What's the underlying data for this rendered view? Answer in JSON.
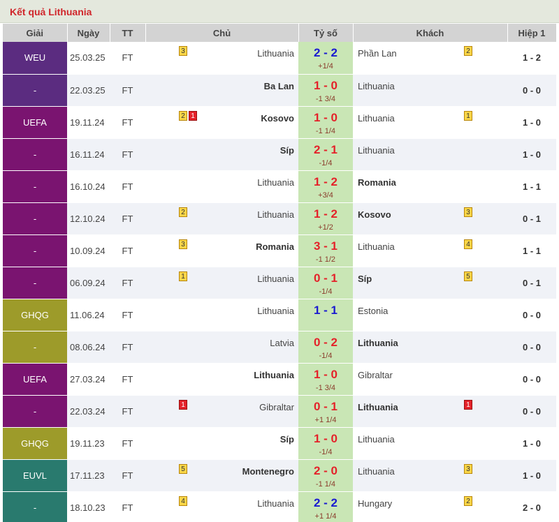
{
  "title": "Kết quả Lithuania",
  "headers": {
    "league": "Giải",
    "date": "Ngày",
    "status": "TT",
    "home": "Chủ",
    "score": "Tỷ số",
    "away": "Khách",
    "half": "Hiệp 1"
  },
  "colors": {
    "purple": "#5b2c80",
    "magenta": "#7a1470",
    "olive": "#9d9b2a",
    "teal": "#297a6e",
    "score_bg": "#c9e6b5",
    "title_red": "#d0262b"
  },
  "matches": [
    {
      "league": "WEU",
      "league_color": "#5b2c80",
      "date": "25.03.25",
      "status": "FT",
      "home": "Lithuania",
      "home_bold": false,
      "home_badges": [
        {
          "n": "3",
          "c": "yellow"
        }
      ],
      "score": "2 - 2",
      "score_color": "blue",
      "handicap": "+1/4",
      "away": "Phần Lan",
      "away_bold": false,
      "away_badges": [
        {
          "n": "2",
          "c": "yellow"
        }
      ],
      "half": "1 - 2"
    },
    {
      "league": "-",
      "league_color": "#5b2c80",
      "date": "22.03.25",
      "status": "FT",
      "home": "Ba Lan",
      "home_bold": true,
      "home_badges": [],
      "score": "1 - 0",
      "score_color": "red",
      "handicap": "-1 3/4",
      "away": "Lithuania",
      "away_bold": false,
      "away_badges": [],
      "half": "0 - 0"
    },
    {
      "league": "UEFA",
      "league_color": "#7a1470",
      "date": "19.11.24",
      "status": "FT",
      "home": "Kosovo",
      "home_bold": true,
      "home_badges": [
        {
          "n": "2",
          "c": "yellow"
        },
        {
          "n": "1",
          "c": "red"
        }
      ],
      "score": "1 - 0",
      "score_color": "red",
      "handicap": "-1 1/4",
      "away": "Lithuania",
      "away_bold": false,
      "away_badges": [
        {
          "n": "1",
          "c": "yellow"
        }
      ],
      "half": "1 - 0"
    },
    {
      "league": "-",
      "league_color": "#7a1470",
      "date": "16.11.24",
      "status": "FT",
      "home": "Síp",
      "home_bold": true,
      "home_badges": [],
      "score": "2 - 1",
      "score_color": "red",
      "handicap": "-1/4",
      "away": "Lithuania",
      "away_bold": false,
      "away_badges": [],
      "half": "1 - 0"
    },
    {
      "league": "-",
      "league_color": "#7a1470",
      "date": "16.10.24",
      "status": "FT",
      "home": "Lithuania",
      "home_bold": false,
      "home_badges": [],
      "score": "1 - 2",
      "score_color": "red",
      "handicap": "+3/4",
      "away": "Romania",
      "away_bold": true,
      "away_badges": [],
      "half": "1 - 1"
    },
    {
      "league": "-",
      "league_color": "#7a1470",
      "date": "12.10.24",
      "status": "FT",
      "home": "Lithuania",
      "home_bold": false,
      "home_badges": [
        {
          "n": "2",
          "c": "yellow"
        }
      ],
      "score": "1 - 2",
      "score_color": "red",
      "handicap": "+1/2",
      "away": "Kosovo",
      "away_bold": true,
      "away_badges": [
        {
          "n": "3",
          "c": "yellow"
        }
      ],
      "half": "0 - 1"
    },
    {
      "league": "-",
      "league_color": "#7a1470",
      "date": "10.09.24",
      "status": "FT",
      "home": "Romania",
      "home_bold": true,
      "home_badges": [
        {
          "n": "3",
          "c": "yellow"
        }
      ],
      "score": "3 - 1",
      "score_color": "red",
      "handicap": "-1 1/2",
      "away": "Lithuania",
      "away_bold": false,
      "away_badges": [
        {
          "n": "4",
          "c": "yellow"
        }
      ],
      "half": "1 - 1"
    },
    {
      "league": "-",
      "league_color": "#7a1470",
      "date": "06.09.24",
      "status": "FT",
      "home": "Lithuania",
      "home_bold": false,
      "home_badges": [
        {
          "n": "1",
          "c": "yellow"
        }
      ],
      "score": "0 - 1",
      "score_color": "red",
      "handicap": "-1/4",
      "away": "Síp",
      "away_bold": true,
      "away_badges": [
        {
          "n": "5",
          "c": "yellow"
        }
      ],
      "half": "0 - 1"
    },
    {
      "league": "GHQG",
      "league_color": "#9d9b2a",
      "date": "11.06.24",
      "status": "FT",
      "home": "Lithuania",
      "home_bold": false,
      "home_badges": [],
      "score": "1 - 1",
      "score_color": "blue",
      "handicap": "",
      "away": "Estonia",
      "away_bold": false,
      "away_badges": [],
      "half": "0 - 0"
    },
    {
      "league": "-",
      "league_color": "#9d9b2a",
      "date": "08.06.24",
      "status": "FT",
      "home": "Latvia",
      "home_bold": false,
      "home_badges": [],
      "score": "0 - 2",
      "score_color": "red",
      "handicap": "-1/4",
      "away": "Lithuania",
      "away_bold": true,
      "away_badges": [],
      "half": "0 - 0"
    },
    {
      "league": "UEFA",
      "league_color": "#7a1470",
      "date": "27.03.24",
      "status": "FT",
      "home": "Lithuania",
      "home_bold": true,
      "home_badges": [],
      "score": "1 - 0",
      "score_color": "red",
      "handicap": "-1 3/4",
      "away": "Gibraltar",
      "away_bold": false,
      "away_badges": [],
      "half": "0 - 0"
    },
    {
      "league": "-",
      "league_color": "#7a1470",
      "date": "22.03.24",
      "status": "FT",
      "home": "Gibraltar",
      "home_bold": false,
      "home_badges": [
        {
          "n": "1",
          "c": "red"
        }
      ],
      "score": "0 - 1",
      "score_color": "red",
      "handicap": "+1 1/4",
      "away": "Lithuania",
      "away_bold": true,
      "away_badges": [
        {
          "n": "1",
          "c": "red"
        }
      ],
      "half": "0 - 0"
    },
    {
      "league": "GHQG",
      "league_color": "#9d9b2a",
      "date": "19.11.23",
      "status": "FT",
      "home": "Síp",
      "home_bold": true,
      "home_badges": [],
      "score": "1 - 0",
      "score_color": "red",
      "handicap": "-1/4",
      "away": "Lithuania",
      "away_bold": false,
      "away_badges": [],
      "half": "1 - 0"
    },
    {
      "league": "EUVL",
      "league_color": "#297a6e",
      "date": "17.11.23",
      "status": "FT",
      "home": "Montenegro",
      "home_bold": true,
      "home_badges": [
        {
          "n": "5",
          "c": "yellow"
        }
      ],
      "score": "2 - 0",
      "score_color": "red",
      "handicap": "-1 1/4",
      "away": "Lithuania",
      "away_bold": false,
      "away_badges": [
        {
          "n": "3",
          "c": "yellow"
        }
      ],
      "half": "1 - 0"
    },
    {
      "league": "-",
      "league_color": "#297a6e",
      "date": "18.10.23",
      "status": "FT",
      "home": "Lithuania",
      "home_bold": false,
      "home_badges": [
        {
          "n": "4",
          "c": "yellow"
        }
      ],
      "score": "2 - 2",
      "score_color": "blue",
      "handicap": "+1 1/4",
      "away": "Hungary",
      "away_bold": false,
      "away_badges": [
        {
          "n": "2",
          "c": "yellow"
        }
      ],
      "half": "2 - 0"
    }
  ]
}
